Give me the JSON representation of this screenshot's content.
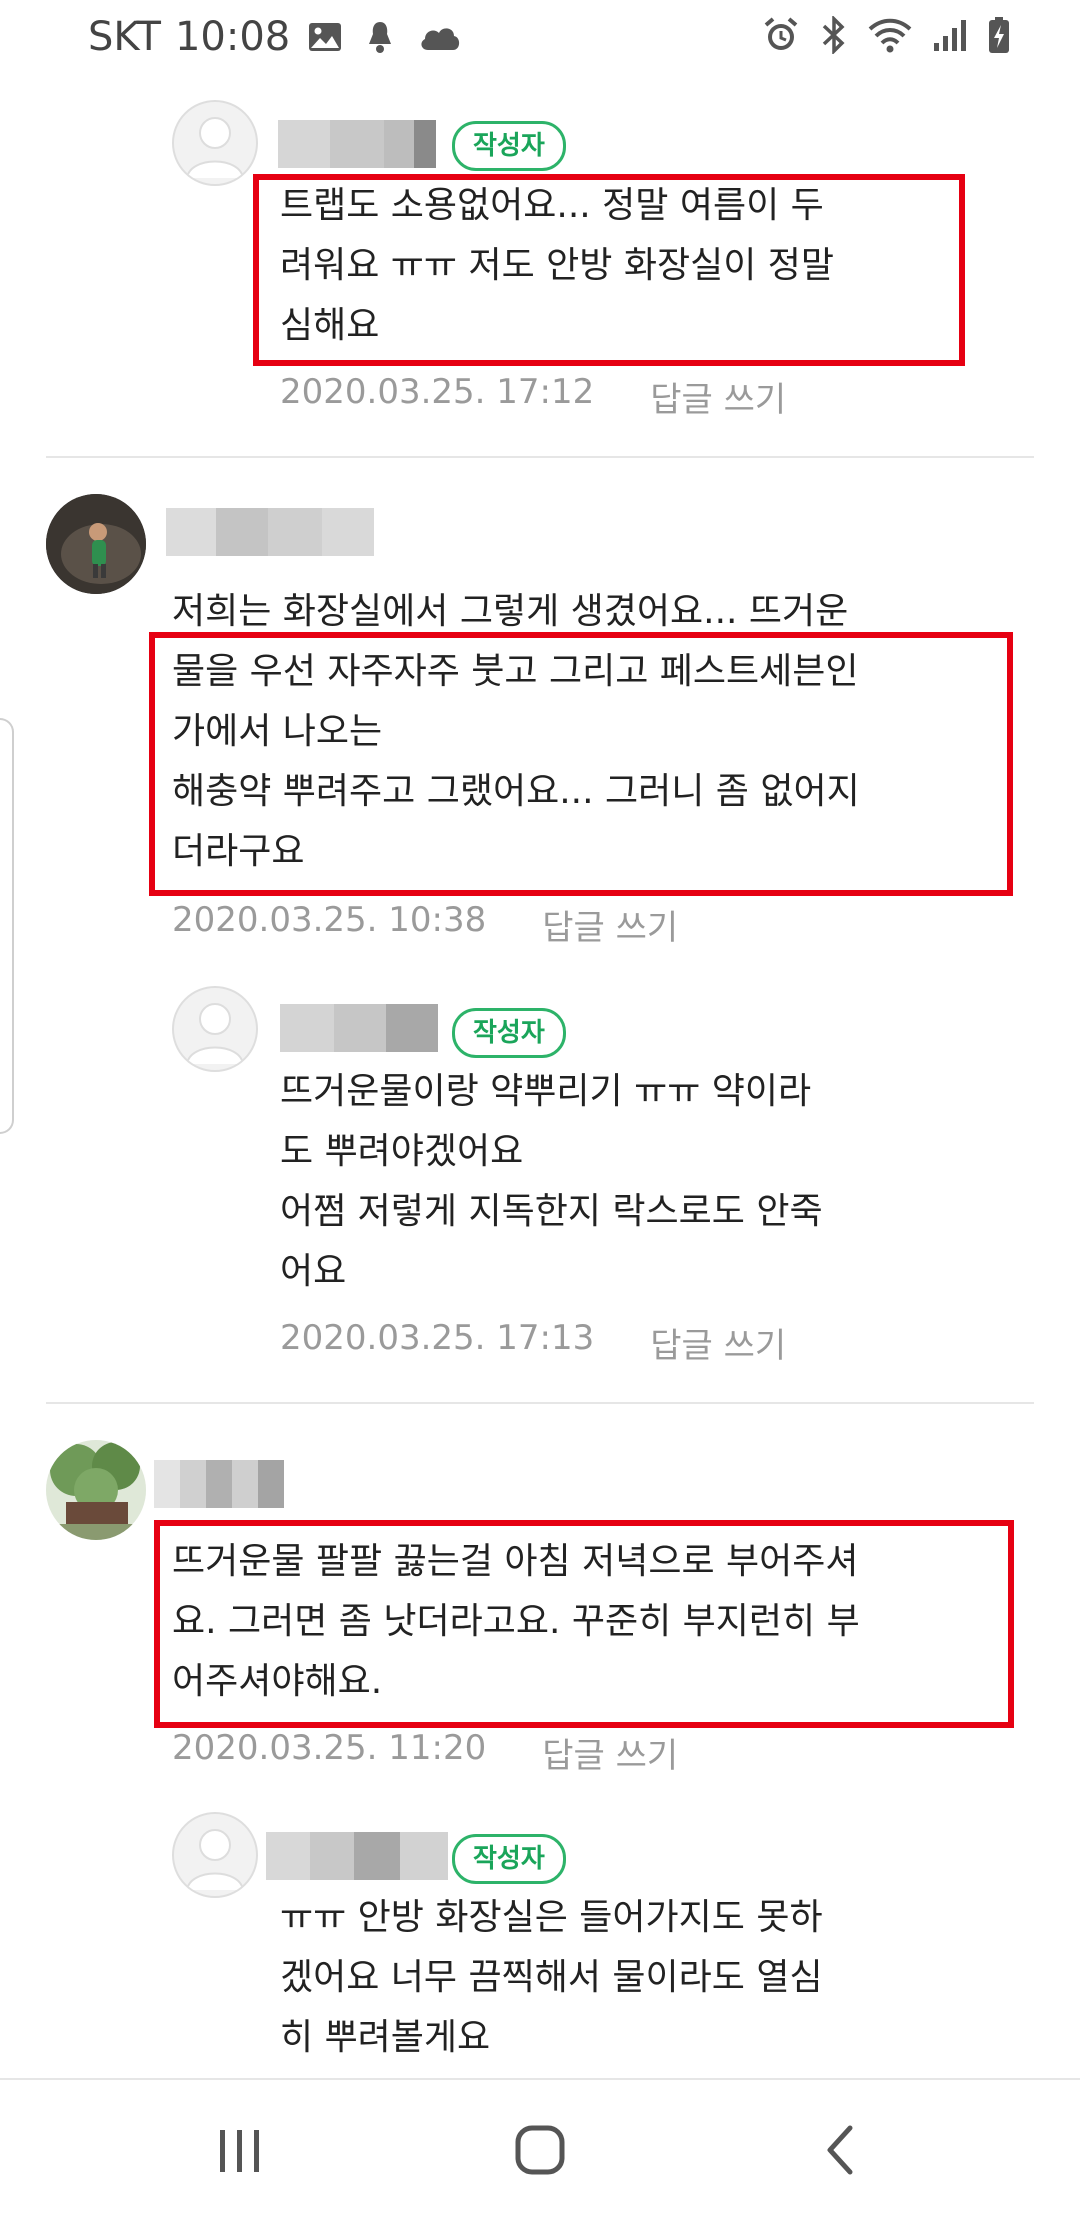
{
  "status_bar": {
    "carrier": "SKT",
    "time": "10:08",
    "left_icons": [
      "image-icon",
      "notification-icon",
      "cloud-icon"
    ],
    "right_icons": [
      "alarm-icon",
      "bluetooth-icon",
      "wifi-icon",
      "signal-icon",
      "battery-icon"
    ]
  },
  "comments": [
    {
      "is_reply": true,
      "author_badge": "작성자",
      "lines": [
        "트랩도 소용없어요... 정말 여름이 두",
        "려워요 ㅠㅠ 저도 안방 화장실이 정말",
        "심해요"
      ],
      "date": "2020.03.25. 17:12",
      "reply_label": "답글 쓰기",
      "highlighted": true
    },
    {
      "is_reply": false,
      "lines": [
        "저희는 화장실에서 그렇게 생겼어요... 뜨거운",
        "물을 우선 자주자주 붓고 그리고 페스트세븐인",
        "가에서 나오는",
        "해충약 뿌려주고 그랬어요... 그러니 좀 없어지",
        "더라구요"
      ],
      "date": "2020.03.25. 10:38",
      "reply_label": "답글 쓰기",
      "highlighted": true
    },
    {
      "is_reply": true,
      "author_badge": "작성자",
      "lines": [
        "뜨거운물이랑 약뿌리기 ㅠㅠ 약이라",
        "도 뿌려야겠어요",
        "어쩜 저렇게 지독한지 락스로도 안죽",
        "어요"
      ],
      "date": "2020.03.25. 17:13",
      "reply_label": "답글 쓰기",
      "highlighted": false
    },
    {
      "is_reply": false,
      "lines": [
        "뜨거운물 팔팔 끓는걸 아침 저녁으로 부어주셔",
        "요. 그러면 좀 낫더라고요. 꾸준히 부지런히 부",
        "어주셔야해요."
      ],
      "date": "2020.03.25. 11:20",
      "reply_label": "답글 쓰기",
      "highlighted": true
    },
    {
      "is_reply": true,
      "author_badge": "작성자",
      "lines": [
        "ㅠㅠ 안방 화장실은 들어가지도 못하",
        "겠어요 너무 끔찍해서 물이라도 열심",
        "히 뿌려볼게요"
      ],
      "highlighted": false
    }
  ],
  "nav_bar": {
    "buttons": [
      "recents-button",
      "home-button",
      "back-button"
    ]
  },
  "colors": {
    "highlight": "#e60012",
    "badge": "#2db369",
    "meta": "#9a9a9a"
  }
}
